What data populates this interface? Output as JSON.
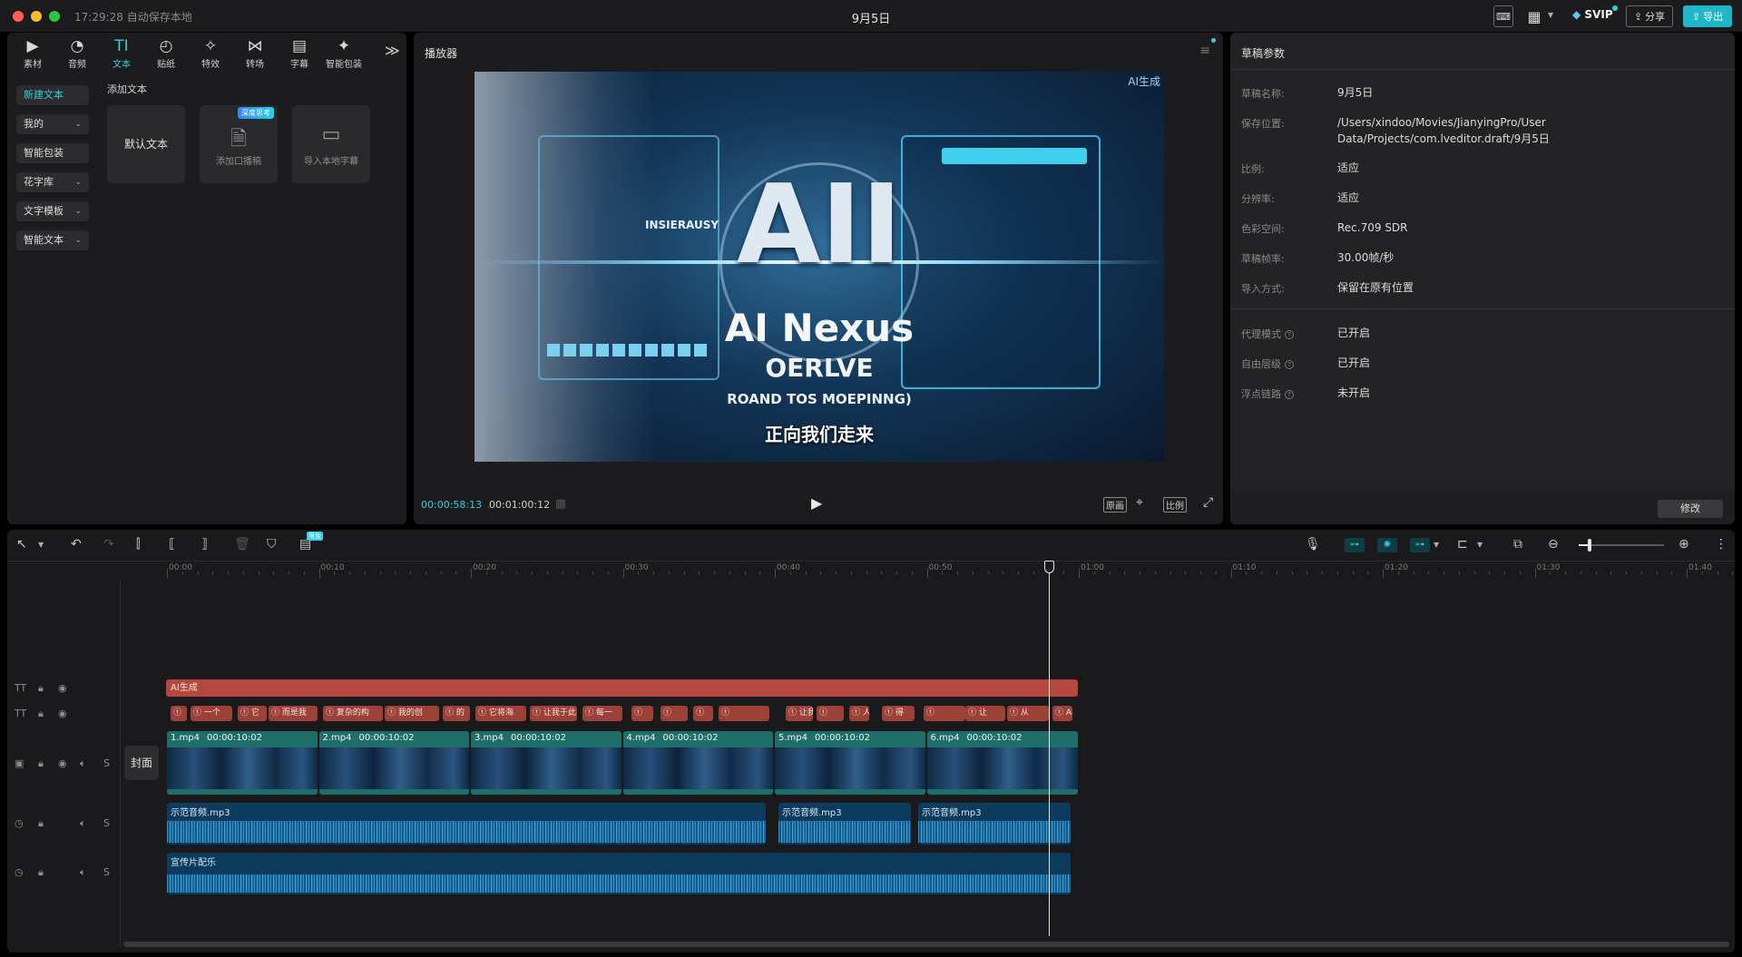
{
  "titlebar": {
    "status": "17:29:28 自动保存本地",
    "title": "9月5日",
    "svip_label": "SVIP",
    "share_label": "分享",
    "export_label": "导出"
  },
  "tools": [
    {
      "label": "素材",
      "icon": "▶"
    },
    {
      "label": "音频",
      "icon": "◔"
    },
    {
      "label": "文本",
      "icon": "TI"
    },
    {
      "label": "贴纸",
      "icon": "◴"
    },
    {
      "label": "特效",
      "icon": "✧"
    },
    {
      "label": "转场",
      "icon": "⋈"
    },
    {
      "label": "字幕",
      "icon": "▤"
    },
    {
      "label": "智能包装",
      "icon": "✦"
    }
  ],
  "sidebar": {
    "items": [
      {
        "label": "新建文本"
      },
      {
        "label": "我的"
      },
      {
        "label": "智能包装"
      },
      {
        "label": "花字库"
      },
      {
        "label": "文字模板"
      },
      {
        "label": "智能文本"
      }
    ]
  },
  "text_panel": {
    "section_title": "添加文本",
    "default_text": "默认文本",
    "add_voice_label": "添加口播稿",
    "add_voice_badge": "深度思考",
    "import_label": "导入本地字幕"
  },
  "player": {
    "title": "播放器",
    "current_time": "00:00:58:13",
    "total_time": "00:01:00:12",
    "ai_tag": "AI生成",
    "main_text": "AII",
    "subtitle_1": "AI Nexus",
    "subtitle_2": "OERLVE",
    "subtitle_3": "ROAND TOS MOEPINNG)",
    "left_label": "INSIERAUSY",
    "caption": "正向我们走来",
    "btn_original": "原画",
    "btn_ratio": "比例"
  },
  "draft": {
    "title": "草稿参数",
    "rows": [
      {
        "label": "草稿名称:",
        "value": "9月5日"
      },
      {
        "label": "保存位置:",
        "value": "/Users/xindoo/Movies/JianyingPro/User Data/Projects/com.lveditor.draft/9月5日"
      },
      {
        "label": "比例:",
        "value": "适应"
      },
      {
        "label": "分辨率:",
        "value": "适应"
      },
      {
        "label": "色彩空间:",
        "value": "Rec.709 SDR"
      },
      {
        "label": "草稿帧率:",
        "value": "30.00帧/秒"
      },
      {
        "label": "导入方式:",
        "value": "保留在原有位置"
      }
    ],
    "rows2": [
      {
        "label": "代理模式",
        "value": "已开启"
      },
      {
        "label": "自由层级",
        "value": "已开启"
      },
      {
        "label": "浮点链路",
        "value": "未开启"
      }
    ],
    "modify_label": "修改"
  },
  "timeline": {
    "toolbar_badge": "限免",
    "ruler": [
      "00:00",
      "00:10",
      "00:20",
      "00:30",
      "00:40",
      "00:50",
      "01:00",
      "01:10",
      "01:20",
      "01:30",
      "01:40"
    ],
    "cover_label": "封面",
    "text_track_clip": "AI生成",
    "subtitle_clips": [
      "",
      "一个",
      "它",
      "而是我",
      "复杂的构",
      "我的创",
      "的",
      "它将海",
      "让我于此",
      "每一",
      "",
      "",
      "",
      "",
      "让我能",
      "",
      "人",
      "得",
      "",
      "让",
      "从",
      "AI已",
      "一个",
      ""
    ],
    "video_clips": [
      {
        "name": "1.mp4",
        "duration": "00:00:10:02"
      },
      {
        "name": "2.mp4",
        "duration": "00:00:10:02"
      },
      {
        "name": "3.mp4",
        "duration": "00:00:10:02"
      },
      {
        "name": "4.mp4",
        "duration": "00:00:10:02"
      },
      {
        "name": "5.mp4",
        "duration": "00:00:10:02"
      },
      {
        "name": "6.mp4",
        "duration": "00:00:10:02"
      }
    ],
    "audio_clips": [
      "示范音频.mp3",
      "示范音频.mp3",
      "示范音频.mp3"
    ],
    "bgm_clip": "宣传片配乐",
    "track_s": "S"
  },
  "colors": {
    "accent": "#2fd0e0",
    "subtitle_clip": "#9c4038",
    "video_clip": "#1f6e6a",
    "audio_clip": "#0d3b5e"
  }
}
